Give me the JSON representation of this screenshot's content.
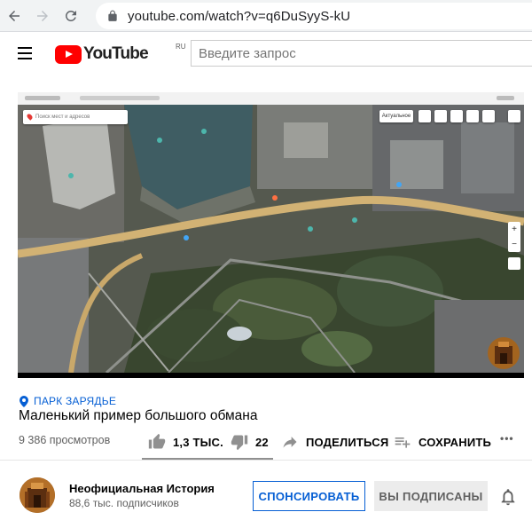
{
  "browser": {
    "url": "youtube.com/watch?v=q6DuSyyS-kU"
  },
  "header": {
    "logo_text": "YouTube",
    "logo_region": "RU",
    "search_placeholder": "Введите запрос"
  },
  "video": {
    "location": "ПАРК ЗАРЯДЬЕ",
    "title": "Маленький пример большого обмана",
    "views": "9 386 просмотров",
    "map_search_placeholder": "Поиск мест и адресов",
    "map_layer_label": "Актуальное"
  },
  "actions": {
    "like_count": "1,3 ТЫС.",
    "dislike_count": "22",
    "share_label": "ПОДЕЛИТЬСЯ",
    "save_label": "СОХРАНИТЬ",
    "more_label": "•••"
  },
  "channel": {
    "name": "Неофициальная История",
    "subscribers": "88,6 тыс. подписчиков",
    "sponsor_label": "СПОНСИРОВАТЬ",
    "subscribed_label": "ВЫ ПОДПИСАНЫ"
  },
  "colors": {
    "accent": "#065fd4",
    "brand_red": "#ff0000",
    "text_primary": "#030303",
    "text_secondary": "#606060"
  }
}
